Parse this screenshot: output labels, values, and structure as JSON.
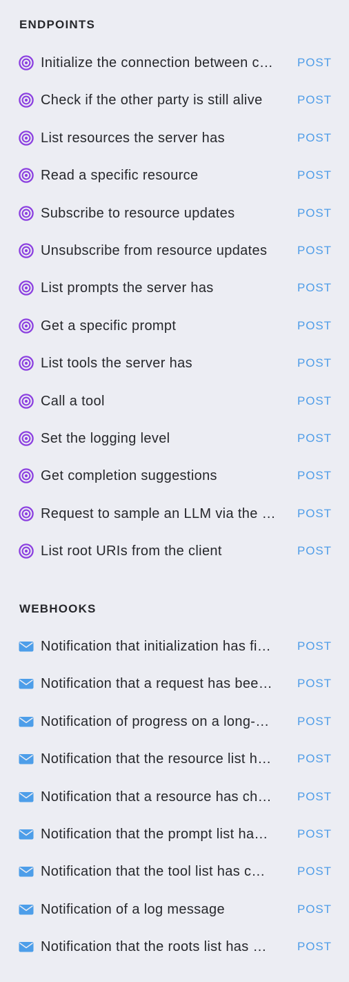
{
  "colors": {
    "background": "#ecedf3",
    "text": "#26272b",
    "method": "#4f9de8",
    "endpoint_icon": "#8b3fe0",
    "webhook_icon": "#4d9ee9"
  },
  "endpoints": {
    "title": "ENDPOINTS",
    "icon": "target-icon",
    "items": [
      {
        "label": "Initialize the connection between c…",
        "method": "POST"
      },
      {
        "label": "Check if the other party is still alive",
        "method": "POST"
      },
      {
        "label": "List resources the server has",
        "method": "POST"
      },
      {
        "label": "Read a specific resource",
        "method": "POST"
      },
      {
        "label": "Subscribe to resource updates",
        "method": "POST"
      },
      {
        "label": "Unsubscribe from resource updates",
        "method": "POST"
      },
      {
        "label": "List prompts the server has",
        "method": "POST"
      },
      {
        "label": "Get a specific prompt",
        "method": "POST"
      },
      {
        "label": "List tools the server has",
        "method": "POST"
      },
      {
        "label": "Call a tool",
        "method": "POST"
      },
      {
        "label": "Set the logging level",
        "method": "POST"
      },
      {
        "label": "Get completion suggestions",
        "method": "POST"
      },
      {
        "label": "Request to sample an LLM via the …",
        "method": "POST"
      },
      {
        "label": "List root URIs from the client",
        "method": "POST"
      }
    ]
  },
  "webhooks": {
    "title": "WEBHOOKS",
    "icon": "envelope-icon",
    "items": [
      {
        "label": "Notification that initialization has fi…",
        "method": "POST"
      },
      {
        "label": "Notification that a request has bee…",
        "method": "POST"
      },
      {
        "label": "Notification of progress on a long-…",
        "method": "POST"
      },
      {
        "label": "Notification that the resource list h…",
        "method": "POST"
      },
      {
        "label": "Notification that a resource has ch…",
        "method": "POST"
      },
      {
        "label": "Notification that the prompt list ha…",
        "method": "POST"
      },
      {
        "label": "Notification that the tool list has c…",
        "method": "POST"
      },
      {
        "label": "Notification of a log message",
        "method": "POST"
      },
      {
        "label": "Notification that the roots list has …",
        "method": "POST"
      }
    ]
  }
}
